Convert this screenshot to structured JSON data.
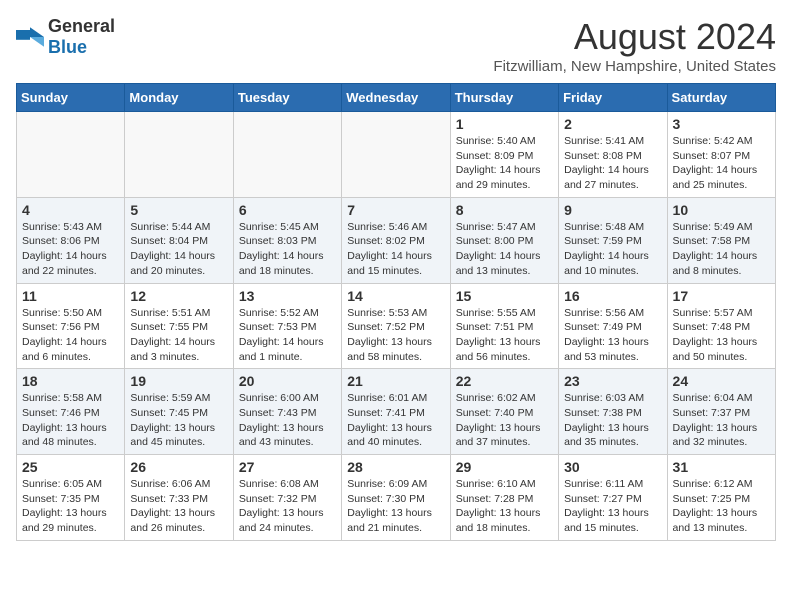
{
  "logo": {
    "general": "General",
    "blue": "Blue"
  },
  "header": {
    "month": "August 2024",
    "location": "Fitzwilliam, New Hampshire, United States"
  },
  "weekdays": [
    "Sunday",
    "Monday",
    "Tuesday",
    "Wednesday",
    "Thursday",
    "Friday",
    "Saturday"
  ],
  "weeks": [
    {
      "days": [
        {
          "num": "",
          "info": ""
        },
        {
          "num": "",
          "info": ""
        },
        {
          "num": "",
          "info": ""
        },
        {
          "num": "",
          "info": ""
        },
        {
          "num": "1",
          "info": "Sunrise: 5:40 AM\nSunset: 8:09 PM\nDaylight: 14 hours\nand 29 minutes."
        },
        {
          "num": "2",
          "info": "Sunrise: 5:41 AM\nSunset: 8:08 PM\nDaylight: 14 hours\nand 27 minutes."
        },
        {
          "num": "3",
          "info": "Sunrise: 5:42 AM\nSunset: 8:07 PM\nDaylight: 14 hours\nand 25 minutes."
        }
      ]
    },
    {
      "days": [
        {
          "num": "4",
          "info": "Sunrise: 5:43 AM\nSunset: 8:06 PM\nDaylight: 14 hours\nand 22 minutes."
        },
        {
          "num": "5",
          "info": "Sunrise: 5:44 AM\nSunset: 8:04 PM\nDaylight: 14 hours\nand 20 minutes."
        },
        {
          "num": "6",
          "info": "Sunrise: 5:45 AM\nSunset: 8:03 PM\nDaylight: 14 hours\nand 18 minutes."
        },
        {
          "num": "7",
          "info": "Sunrise: 5:46 AM\nSunset: 8:02 PM\nDaylight: 14 hours\nand 15 minutes."
        },
        {
          "num": "8",
          "info": "Sunrise: 5:47 AM\nSunset: 8:00 PM\nDaylight: 14 hours\nand 13 minutes."
        },
        {
          "num": "9",
          "info": "Sunrise: 5:48 AM\nSunset: 7:59 PM\nDaylight: 14 hours\nand 10 minutes."
        },
        {
          "num": "10",
          "info": "Sunrise: 5:49 AM\nSunset: 7:58 PM\nDaylight: 14 hours\nand 8 minutes."
        }
      ]
    },
    {
      "days": [
        {
          "num": "11",
          "info": "Sunrise: 5:50 AM\nSunset: 7:56 PM\nDaylight: 14 hours\nand 6 minutes."
        },
        {
          "num": "12",
          "info": "Sunrise: 5:51 AM\nSunset: 7:55 PM\nDaylight: 14 hours\nand 3 minutes."
        },
        {
          "num": "13",
          "info": "Sunrise: 5:52 AM\nSunset: 7:53 PM\nDaylight: 14 hours\nand 1 minute."
        },
        {
          "num": "14",
          "info": "Sunrise: 5:53 AM\nSunset: 7:52 PM\nDaylight: 13 hours\nand 58 minutes."
        },
        {
          "num": "15",
          "info": "Sunrise: 5:55 AM\nSunset: 7:51 PM\nDaylight: 13 hours\nand 56 minutes."
        },
        {
          "num": "16",
          "info": "Sunrise: 5:56 AM\nSunset: 7:49 PM\nDaylight: 13 hours\nand 53 minutes."
        },
        {
          "num": "17",
          "info": "Sunrise: 5:57 AM\nSunset: 7:48 PM\nDaylight: 13 hours\nand 50 minutes."
        }
      ]
    },
    {
      "days": [
        {
          "num": "18",
          "info": "Sunrise: 5:58 AM\nSunset: 7:46 PM\nDaylight: 13 hours\nand 48 minutes."
        },
        {
          "num": "19",
          "info": "Sunrise: 5:59 AM\nSunset: 7:45 PM\nDaylight: 13 hours\nand 45 minutes."
        },
        {
          "num": "20",
          "info": "Sunrise: 6:00 AM\nSunset: 7:43 PM\nDaylight: 13 hours\nand 43 minutes."
        },
        {
          "num": "21",
          "info": "Sunrise: 6:01 AM\nSunset: 7:41 PM\nDaylight: 13 hours\nand 40 minutes."
        },
        {
          "num": "22",
          "info": "Sunrise: 6:02 AM\nSunset: 7:40 PM\nDaylight: 13 hours\nand 37 minutes."
        },
        {
          "num": "23",
          "info": "Sunrise: 6:03 AM\nSunset: 7:38 PM\nDaylight: 13 hours\nand 35 minutes."
        },
        {
          "num": "24",
          "info": "Sunrise: 6:04 AM\nSunset: 7:37 PM\nDaylight: 13 hours\nand 32 minutes."
        }
      ]
    },
    {
      "days": [
        {
          "num": "25",
          "info": "Sunrise: 6:05 AM\nSunset: 7:35 PM\nDaylight: 13 hours\nand 29 minutes."
        },
        {
          "num": "26",
          "info": "Sunrise: 6:06 AM\nSunset: 7:33 PM\nDaylight: 13 hours\nand 26 minutes."
        },
        {
          "num": "27",
          "info": "Sunrise: 6:08 AM\nSunset: 7:32 PM\nDaylight: 13 hours\nand 24 minutes."
        },
        {
          "num": "28",
          "info": "Sunrise: 6:09 AM\nSunset: 7:30 PM\nDaylight: 13 hours\nand 21 minutes."
        },
        {
          "num": "29",
          "info": "Sunrise: 6:10 AM\nSunset: 7:28 PM\nDaylight: 13 hours\nand 18 minutes."
        },
        {
          "num": "30",
          "info": "Sunrise: 6:11 AM\nSunset: 7:27 PM\nDaylight: 13 hours\nand 15 minutes."
        },
        {
          "num": "31",
          "info": "Sunrise: 6:12 AM\nSunset: 7:25 PM\nDaylight: 13 hours\nand 13 minutes."
        }
      ]
    }
  ]
}
